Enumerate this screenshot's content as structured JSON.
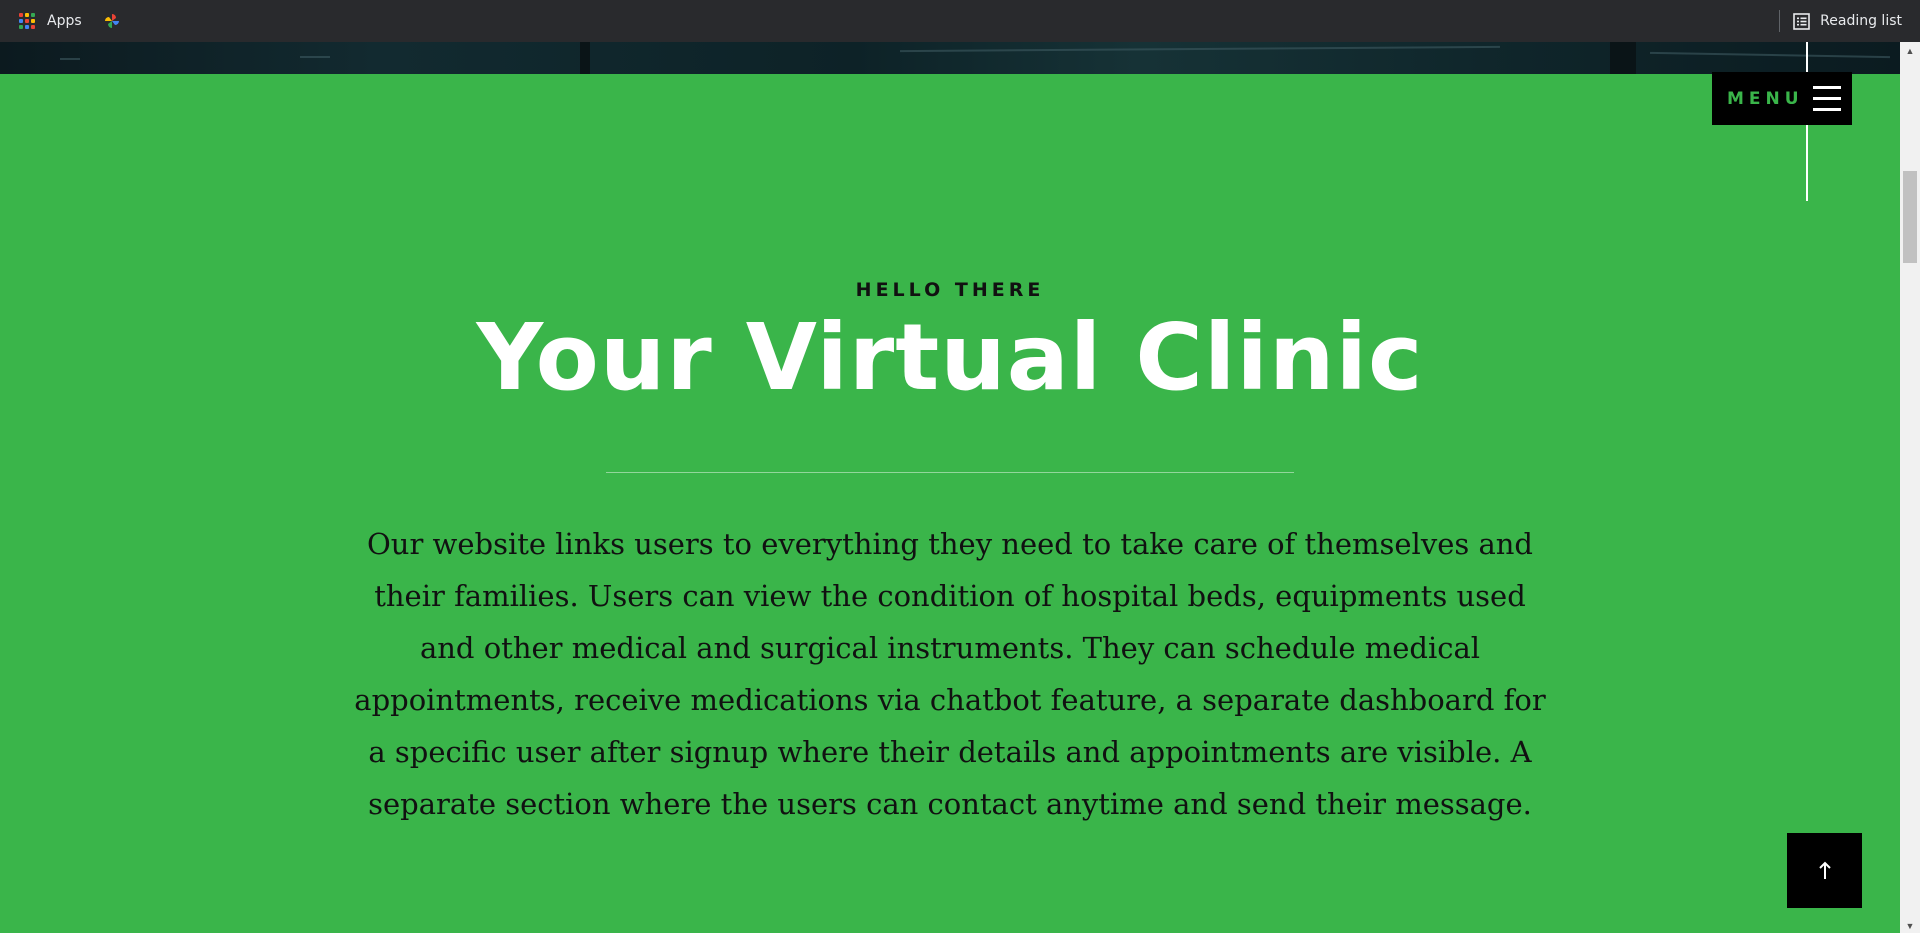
{
  "bookmarks": {
    "apps_label": "Apps",
    "apps_icon": "apps-grid-icon",
    "photos_icon": "google-photos-pinwheel-icon",
    "reading_list_label": "Reading list",
    "reading_list_icon": "reading-list-icon"
  },
  "menu": {
    "label": "MENU",
    "icon": "hamburger-icon"
  },
  "hero": {
    "eyebrow": "HELLO THERE",
    "title": "Your Virtual Clinic",
    "description": "Our website links users to everything they need to take care of themselves and their families. Users can view the condition of hospital beds, equipments used and other medical and surgical instruments. They can schedule medical appointments, receive medications via chatbot feature, a separate dashboard for a specific user after signup where their details and appointments are visible. A separate section where the users can contact anytime and send their message."
  },
  "back_to_top": {
    "icon": "arrow-up-icon"
  },
  "colors": {
    "page_background": "#3ab54a",
    "accent_green": "#3ab54a",
    "button_black": "#000000",
    "title_white": "#ffffff",
    "bookmarks_bar": "#292a2d"
  }
}
